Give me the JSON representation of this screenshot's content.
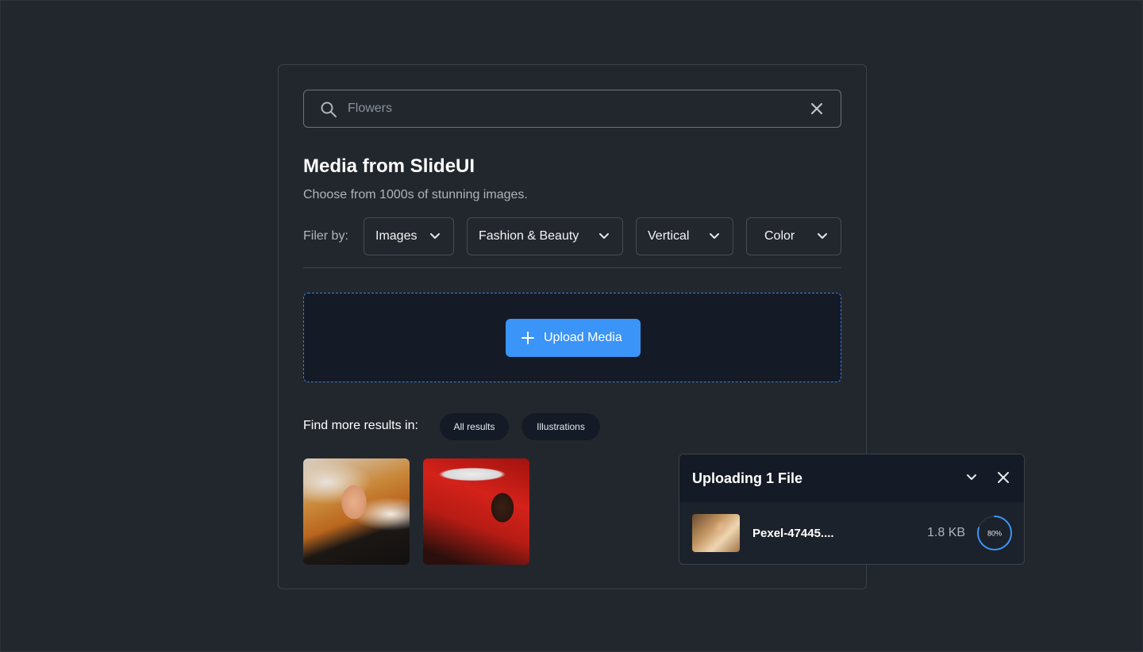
{
  "search": {
    "placeholder": "Flowers",
    "value": ""
  },
  "header": {
    "title": "Media from SlideUI",
    "subtitle": "Choose from 1000s of stunning images."
  },
  "filters": {
    "label": "Filer by:",
    "items": [
      {
        "label": "Images"
      },
      {
        "label": "Fashion & Beauty"
      },
      {
        "label": "Vertical"
      },
      {
        "label": "Color"
      }
    ]
  },
  "upload": {
    "button_label": "Upload Media"
  },
  "more_results": {
    "label": "Find more results in:",
    "chips": [
      {
        "label": "All results"
      },
      {
        "label": "Illustrations"
      }
    ]
  },
  "results": {
    "count": 2
  },
  "upload_toast": {
    "title": "Uploading 1 File",
    "file_name": "Pexel-47445....",
    "file_size": "1.8 KB",
    "progress_percent": 80,
    "progress_label": "80%"
  },
  "colors": {
    "accent": "#3b94f7",
    "background": "#22272e",
    "dropzone_border": "#3f7fd8"
  },
  "icons": [
    "search-icon",
    "close-icon",
    "chevron-down-icon",
    "plus-icon"
  ]
}
